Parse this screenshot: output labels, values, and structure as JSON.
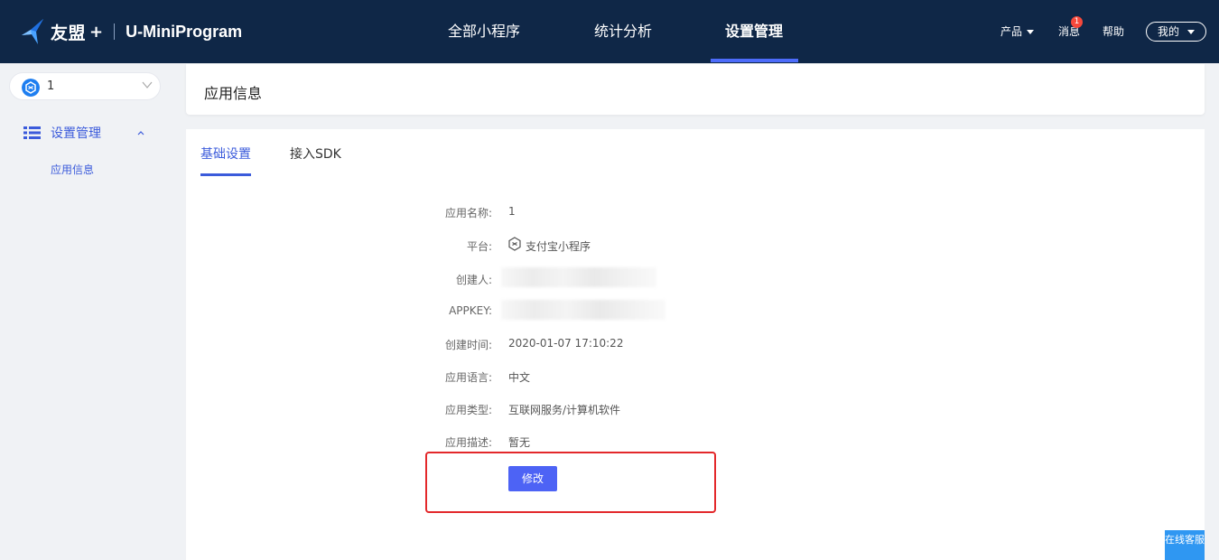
{
  "header": {
    "brand": "友盟",
    "brand_plus": "+",
    "product": "U-MiniProgram",
    "nav": [
      "全部小程序",
      "统计分析",
      "设置管理"
    ],
    "active_nav": "设置管理",
    "right": {
      "product_menu": "产品",
      "messages": "消息",
      "message_count": "1",
      "help": "帮助",
      "mine": "我的"
    }
  },
  "sidebar": {
    "app_selector": "1",
    "menu_group": "设置管理",
    "menu_items": [
      "应用信息"
    ]
  },
  "page": {
    "title": "应用信息",
    "tabs": [
      "基础设置",
      "接入SDK"
    ],
    "active_tab": "基础设置",
    "fields": {
      "name_label": "应用名称:",
      "name_value": "1",
      "platform_label": "平台:",
      "platform_value": "支付宝小程序",
      "creator_label": "创建人:",
      "appkey_label": "APPKEY:",
      "created_label": "创建时间:",
      "created_value": "2020-01-07 17:10:22",
      "language_label": "应用语言:",
      "language_value": "中文",
      "type_label": "应用类型:",
      "type_value": "互联网服务/计算机软件",
      "desc_label": "应用描述:",
      "desc_value": "暂无"
    },
    "modify_button": "修改"
  },
  "support": {
    "online_service": "在线客服"
  },
  "colors": {
    "header_bg": "#0f2747",
    "accent": "#3b5bdb",
    "button": "#4d63f5",
    "highlight_box": "#e3282b",
    "badge": "#f5483b"
  }
}
